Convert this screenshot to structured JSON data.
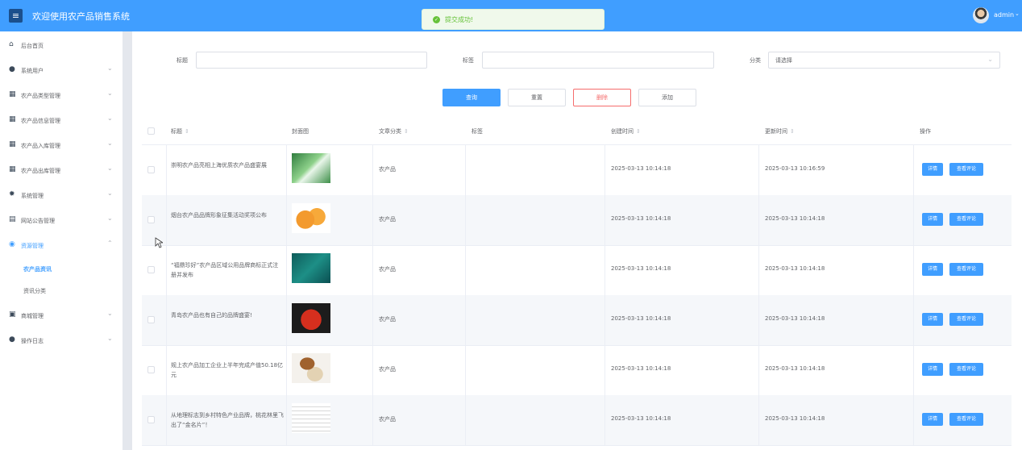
{
  "header": {
    "menu_icon": "menu-icon",
    "title": "欢迎使用农产品销售系统",
    "username": "admin"
  },
  "toast": {
    "message": "提交成功!"
  },
  "sidebar": {
    "items": [
      {
        "label": "后台首页",
        "icon": "home-icon"
      },
      {
        "label": "系统用户",
        "icon": "user-icon"
      },
      {
        "label": "农产品类型管理",
        "icon": "grid-icon"
      },
      {
        "label": "农产品信息管理",
        "icon": "grid-icon"
      },
      {
        "label": "农产品入库管理",
        "icon": "grid-icon"
      },
      {
        "label": "农产品出库管理",
        "icon": "grid-icon"
      },
      {
        "label": "系统管理",
        "icon": "gear-icon"
      },
      {
        "label": "网站公告管理",
        "icon": "notice-icon"
      },
      {
        "label": "资源管理",
        "icon": "resource-icon",
        "expanded": true
      },
      {
        "label": "商城管理",
        "icon": "shop-icon"
      },
      {
        "label": "操作日志",
        "icon": "user-icon"
      }
    ],
    "subitems": [
      {
        "label": "农产品资讯",
        "active": true
      },
      {
        "label": "资讯分类"
      }
    ]
  },
  "filters": {
    "title_label": "标题",
    "tags_label": "标签",
    "category_label": "分类",
    "category_placeholder": "请选择"
  },
  "buttons": {
    "search": "查询",
    "reset": "重置",
    "delete": "删除",
    "add": "添加"
  },
  "table": {
    "headers": [
      "标题",
      "封面图",
      "文章分类",
      "标签",
      "创建时间",
      "更新时间",
      "操作"
    ],
    "action_detail": "详情",
    "action_comments": "查看评论",
    "rows": [
      {
        "title": "崇明农产品亮相上海优质农产品盛宴展",
        "category": "农产品",
        "tags": "",
        "created": "2025-03-13 10:14:18",
        "updated": "2025-03-13 10:16:59"
      },
      {
        "title": "烟台农产品品牌形象征集活动奖项公布",
        "category": "农产品",
        "tags": "",
        "created": "2025-03-13 10:14:18",
        "updated": "2025-03-13 10:14:18"
      },
      {
        "title": "“福鼎珍好”农产品区域公用品牌商标正式注册并发布",
        "category": "农产品",
        "tags": "",
        "created": "2025-03-13 10:14:18",
        "updated": "2025-03-13 10:14:18"
      },
      {
        "title": "青岛农产品也有自己的品牌盛宴!",
        "category": "农产品",
        "tags": "",
        "created": "2025-03-13 10:14:18",
        "updated": "2025-03-13 10:14:18"
      },
      {
        "title": "规上农产品加工企业上半年完成产值50.18亿元",
        "category": "农产品",
        "tags": "",
        "created": "2025-03-13 10:14:18",
        "updated": "2025-03-13 10:14:18"
      },
      {
        "title": "从地理标志到乡村特色产业品牌，桃花林里飞出了“金名片”！",
        "category": "农产品",
        "tags": "",
        "created": "2025-03-13 10:14:18",
        "updated": "2025-03-13 10:14:18"
      }
    ]
  }
}
